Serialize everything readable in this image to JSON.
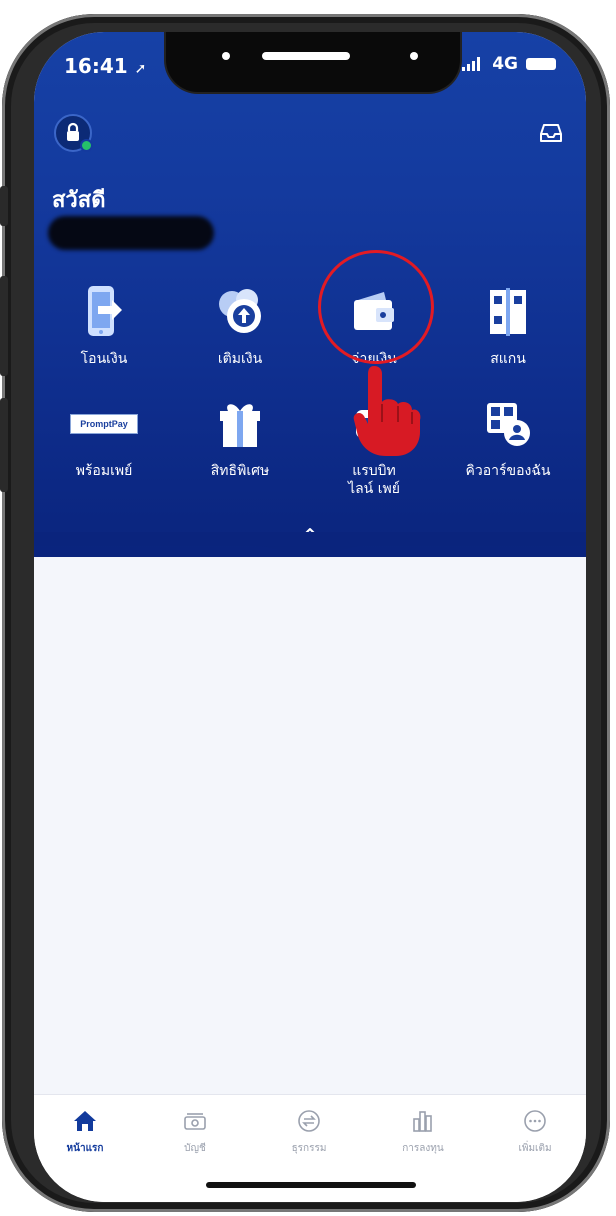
{
  "status": {
    "time": "16:41",
    "network": "4G"
  },
  "header": {
    "greeting": "สวัสดี"
  },
  "menu": [
    {
      "id": "transfer",
      "label": "โอนเงิน",
      "icon": "phone-transfer-icon"
    },
    {
      "id": "topup",
      "label": "เติมเงิน",
      "icon": "cloud-upload-icon"
    },
    {
      "id": "pay",
      "label": "จ่ายเงิน",
      "icon": "wallet-icon"
    },
    {
      "id": "scan",
      "label": "สแกน",
      "icon": "qr-scan-icon"
    },
    {
      "id": "promptpay",
      "label": "พร้อมเพย์",
      "icon": "promptpay-logo-icon",
      "logo_text": "PromptPay"
    },
    {
      "id": "privilege",
      "label": "สิทธิพิเศษ",
      "icon": "gift-icon"
    },
    {
      "id": "rabbit",
      "label_line1": "แรบบิท",
      "label_line2": "ไลน์ เพย์",
      "icon": "rabbit-line-pay-icon"
    },
    {
      "id": "myqr",
      "label": "คิวอาร์ของฉัน",
      "icon": "my-qr-icon"
    }
  ],
  "tabs": [
    {
      "id": "home",
      "label": "หน้าแรก",
      "active": true
    },
    {
      "id": "accounts",
      "label": "บัญชี",
      "active": false
    },
    {
      "id": "transactions",
      "label": "ธุรกรรม",
      "active": false
    },
    {
      "id": "invest",
      "label": "การลงทุน",
      "active": false
    },
    {
      "id": "more",
      "label": "เพิ่มเติม",
      "active": false
    }
  ],
  "colors": {
    "brand": "#143a9e",
    "highlight": "#e21b24",
    "tab_active": "#123a9c",
    "tab_inactive": "#9aa0ad"
  }
}
